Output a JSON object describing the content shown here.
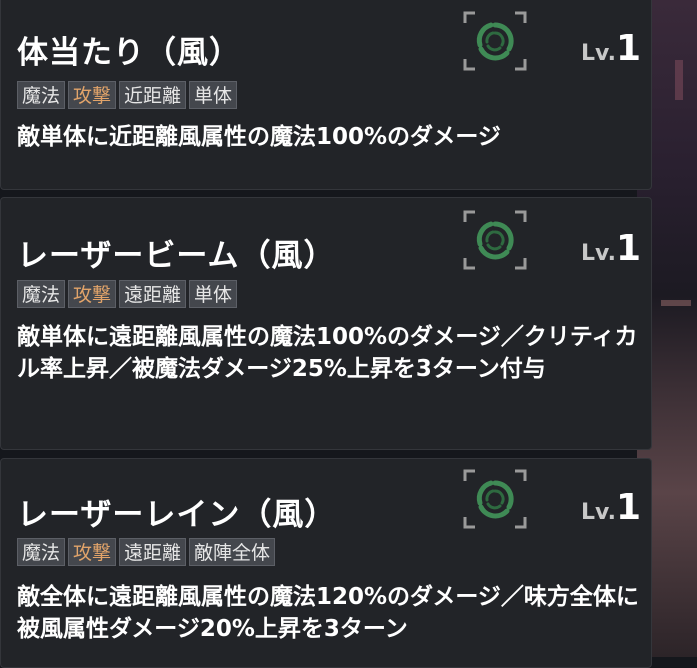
{
  "skills": [
    {
      "name": "体当たり（風）",
      "tags": [
        {
          "label": "魔法",
          "type": "normal"
        },
        {
          "label": "攻撃",
          "type": "attack"
        },
        {
          "label": "近距離",
          "type": "normal"
        },
        {
          "label": "単体",
          "type": "normal"
        }
      ],
      "description": "敵単体に近距離風属性の魔法100%のダメージ",
      "element_icon": "wind-element-icon",
      "level_prefix": "Lv.",
      "level": "1"
    },
    {
      "name": "レーザービーム（風）",
      "tags": [
        {
          "label": "魔法",
          "type": "normal"
        },
        {
          "label": "攻撃",
          "type": "attack"
        },
        {
          "label": "遠距離",
          "type": "normal"
        },
        {
          "label": "単体",
          "type": "normal"
        }
      ],
      "description": "敵単体に遠距離風属性の魔法100%のダメージ／クリティカル率上昇／被魔法ダメージ25%上昇を3ターン付与",
      "element_icon": "wind-element-icon",
      "level_prefix": "Lv.",
      "level": "1"
    },
    {
      "name": "レーザーレイン（風）",
      "tags": [
        {
          "label": "魔法",
          "type": "normal"
        },
        {
          "label": "攻撃",
          "type": "attack"
        },
        {
          "label": "遠距離",
          "type": "normal"
        },
        {
          "label": "敵陣全体",
          "type": "normal"
        }
      ],
      "description": "敵全体に遠距離風属性の魔法120%のダメージ／味方全体に被風属性ダメージ20%上昇を3ターン",
      "element_icon": "wind-element-icon",
      "level_prefix": "Lv.",
      "level": "1"
    }
  ],
  "colors": {
    "card_bg": "#222428",
    "tag_bg": "#44474d",
    "attack_tag_text": "#e2a46a",
    "wind_icon": "#3f8a55"
  }
}
